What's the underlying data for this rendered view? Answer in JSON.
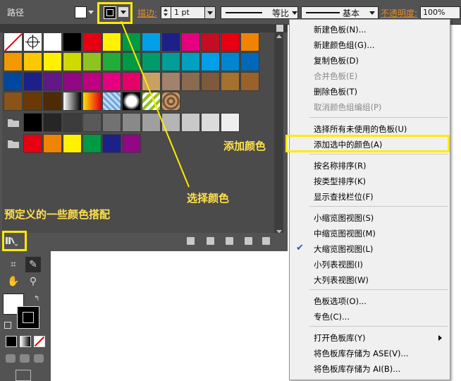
{
  "control_bar": {
    "panel_name": "路径",
    "stroke_label": "描边:",
    "stroke_weight": "1 pt",
    "dash_label": "等比",
    "profile_label": "基本",
    "opacity_label": "不透明度:",
    "opacity_value": "100%"
  },
  "swatches": {
    "rows": [
      [
        "none",
        "reg",
        "#ffffff",
        "#000000",
        "#e60012",
        "#fff100",
        "#009944",
        "#00a0e9",
        "#1d2088",
        "#e4007f",
        "#c30d23",
        "#e60012",
        "#f08300"
      ],
      [
        "#f39800",
        "#fcc800",
        "#fff100",
        "#cfdb00",
        "#8fc31f",
        "#22ac38",
        "#009944",
        "#009b6b",
        "#009e96",
        "#00a0c1",
        "#00a0e9",
        "#0086d1",
        "#0068b7"
      ],
      [
        "#00479d",
        "#1d2088",
        "#601986",
        "#920783",
        "#be0081",
        "#e4007f",
        "#e5006a",
        "#c9a063",
        "#a2826b",
        "#8b6b4f",
        "#7d5a3c",
        "#a5712e",
        "#9a6228"
      ],
      [
        "#8a5418",
        "#6a3906",
        "#4d2b06",
        "grad-bw",
        "grad-orange",
        "pattern-blue",
        "pattern-dots",
        "pattern-green",
        "pattern-swirl"
      ]
    ],
    "gray_row": [
      "#000000",
      "#262626",
      "#3c3c3c",
      "#595959",
      "#727272",
      "#898989",
      "#9f9f9f",
      "#b5b5b5",
      "#c9c9c9",
      "#dcdcdc",
      "#eeeeee"
    ],
    "color_group_row": [
      "#e60012",
      "#f08300",
      "#fff100",
      "#009944",
      "#1d2088",
      "#920783"
    ]
  },
  "menu": {
    "items": [
      {
        "label": "新建色板(N)...",
        "disabled": false
      },
      {
        "label": "新建颜色组(G)...",
        "disabled": false
      },
      {
        "label": "复制色板(D)",
        "disabled": false
      },
      {
        "label": "合并色板(E)",
        "disabled": true
      },
      {
        "label": "删除色板(T)",
        "disabled": false
      },
      {
        "label": "取消颜色组编组(P)",
        "disabled": true
      },
      {
        "label": "选择所有未使用的色板(U)",
        "disabled": false
      },
      {
        "label": "添加选中的颜色(A)",
        "disabled": false
      },
      {
        "label": "按名称排序(R)",
        "disabled": false
      },
      {
        "label": "按类型排序(K)",
        "disabled": false
      },
      {
        "label": "显示查找栏位(F)",
        "disabled": false
      },
      {
        "label": "小缩览图视图(S)",
        "disabled": false
      },
      {
        "label": "中缩览图视图(M)",
        "disabled": false
      },
      {
        "label": "大缩览图视图(L)",
        "disabled": false,
        "checked": true
      },
      {
        "label": "小列表视图(I)",
        "disabled": false
      },
      {
        "label": "大列表视图(W)",
        "disabled": false
      },
      {
        "label": "色板选项(O)...",
        "disabled": false
      },
      {
        "label": "专色(C)...",
        "disabled": false
      },
      {
        "label": "打开色板库(Y)",
        "disabled": false,
        "submenu": true
      },
      {
        "label": "将色板库存储为 ASE(V)...",
        "disabled": false
      },
      {
        "label": "将色板库存储为 AI(B)...",
        "disabled": false
      }
    ]
  },
  "annotations": {
    "add_color": "添加颜色",
    "select_color": "选择颜色",
    "preset_colors": "预定义的一些颜色搭配"
  },
  "colors": {
    "highlight": "#ffeb00",
    "annotation_text": "#ffe14a",
    "panel_bg": "#535353"
  }
}
